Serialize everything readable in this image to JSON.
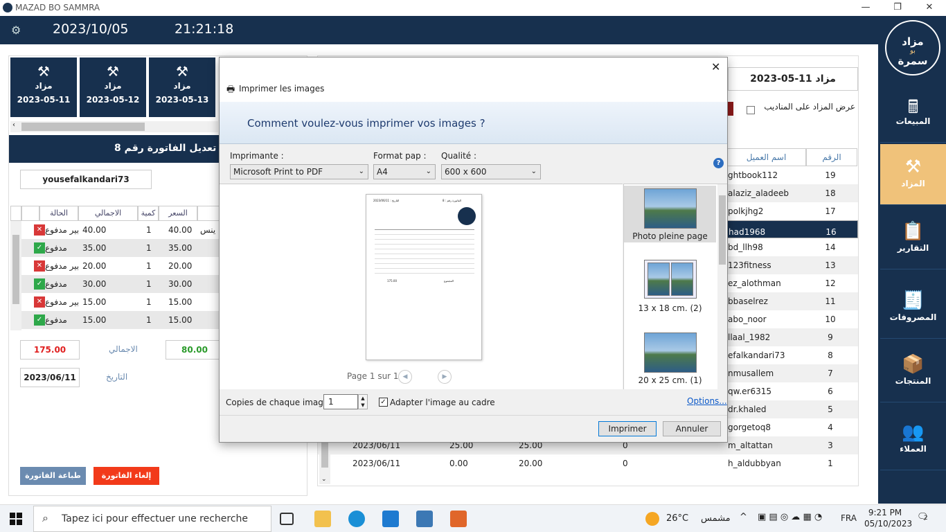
{
  "window": {
    "title": "MAZAD BO SAMMRA",
    "min": "—",
    "max": "❐",
    "close": "✕"
  },
  "topbar": {
    "date": "2023/10/05",
    "time": "21:21:18",
    "gear": "⚙"
  },
  "sidebar": {
    "logo_line1": "مزاد",
    "logo_line2": "بو",
    "logo_line3": "سمرة",
    "logo_sub": "MAZAD BO SAMMRA",
    "items": [
      {
        "label": "المبيعات",
        "icon": "cash-register-icon",
        "glyph": "🖩"
      },
      {
        "label": "المزاد",
        "icon": "gavel-icon",
        "glyph": "⚒"
      },
      {
        "label": "التقارير",
        "icon": "report-icon",
        "glyph": "📋"
      },
      {
        "label": "المصروفات",
        "icon": "expenses-icon",
        "glyph": "🧾"
      },
      {
        "label": "المنتجات",
        "icon": "products-icon",
        "glyph": "📦"
      },
      {
        "label": "العملاء",
        "icon": "customers-icon",
        "glyph": "👥"
      }
    ]
  },
  "left": {
    "cards": [
      {
        "l1": "مزاد",
        "l2": "2023-05-11"
      },
      {
        "l1": "مزاد",
        "l2": "2023-05-12"
      },
      {
        "l1": "مزاد",
        "l2": "2023-05-13"
      }
    ],
    "invoice_title": "تعديل الفاتورة رقم  8",
    "customer": "yousefalkandari73",
    "headers": {
      "status": "الحالة",
      "total": "الاجمالي",
      "qty": "كمية",
      "price": "السعر"
    },
    "rows": [
      {
        "total": "40.00",
        "qty": "1",
        "price": "40.00",
        "status": "بير مدفوع",
        "paid": false,
        "extra": "ينس"
      },
      {
        "total": "35.00",
        "qty": "1",
        "price": "35.00",
        "status": "مدفوع",
        "paid": true,
        "extra": ""
      },
      {
        "total": "20.00",
        "qty": "1",
        "price": "20.00",
        "status": "بير مدفوع",
        "paid": false,
        "extra": ""
      },
      {
        "total": "30.00",
        "qty": "1",
        "price": "30.00",
        "status": "مدفوع",
        "paid": true,
        "extra": ""
      },
      {
        "total": "15.00",
        "qty": "1",
        "price": "15.00",
        "status": "بير مدفوع",
        "paid": false,
        "extra": ""
      },
      {
        "total": "15.00",
        "qty": "1",
        "price": "15.00",
        "status": "مدفوع",
        "paid": true,
        "extra": ""
      }
    ],
    "grand_total": "175.00",
    "total_label": "الاجمالي",
    "paid_total": "80.00",
    "date_value": "2023/06/11",
    "date_label": "التاريخ",
    "print_btn": "طباعة الفاتورة",
    "cancel_btn": "إلغاء الفاتورة"
  },
  "right": {
    "auction_title": "مزاد 11-05-2023",
    "checkbox_label": "عرض المزاد على المناديب",
    "col_num": "الرقم",
    "col_name": "اسم العميل",
    "rows": [
      {
        "num": "19",
        "name": "ghtbook112"
      },
      {
        "num": "18",
        "name": "alaziz_aladeeb"
      },
      {
        "num": "17",
        "name": "polkjhg2"
      },
      {
        "num": "16",
        "name": "had1968"
      },
      {
        "num": "14",
        "name": "bd_llh98"
      },
      {
        "num": "13",
        "name": "123fitness"
      },
      {
        "num": "12",
        "name": "ez_alothman"
      },
      {
        "num": "11",
        "name": "bbaselrez"
      },
      {
        "num": "10",
        "name": "abo_noor"
      },
      {
        "num": "9",
        "name": "llaal_1982"
      },
      {
        "num": "8",
        "name": "efalkandari73"
      },
      {
        "num": "7",
        "name": "nmusallem"
      },
      {
        "num": "6",
        "name": "qw.er6315"
      },
      {
        "num": "5",
        "name": "dr.khaled"
      },
      {
        "num": "4",
        "name": "gorgetoq8"
      },
      {
        "num": "3",
        "name": "m_altattan",
        "date": "2023/06/11",
        "a": "25.00",
        "b": "25.00",
        "c": "0"
      },
      {
        "num": "1",
        "name": "h_aldubbyan",
        "date": "2023/06/11",
        "a": "0.00",
        "b": "20.00",
        "c": "0"
      }
    ]
  },
  "dialog": {
    "title": "Imprimer les images",
    "question": "Comment voulez-vous imprimer vos images ?",
    "printer_label": "Imprimante :",
    "printer": "Microsoft Print to PDF",
    "paper_label": "Format pap :",
    "paper": "A4",
    "quality_label": "Qualité :",
    "quality": "600 x 600",
    "page_info": "Page 1 sur 1",
    "thumbs": [
      {
        "label": "Photo pleine page"
      },
      {
        "label": "13 x 18 cm. (2)"
      },
      {
        "label": "20 x 25 cm. (1)"
      }
    ],
    "copies_label": "Copies de chaque image :",
    "copies": "1",
    "fit_label": "Adapter l'image au cadre",
    "options": "Options...",
    "print": "Imprimer",
    "cancel": "Annuler",
    "doc_title": "الفاتورة رقم : 8",
    "doc_date": "التاريخ : 2023/06/11",
    "doc_total": "175.00",
    "doc_total_label": "المجموع"
  },
  "taskbar": {
    "search": "Tapez ici pour effectuer une recherche",
    "weather": "26°C",
    "weather_text": "مشمس",
    "lang": "FRA",
    "time": "9:21 PM",
    "date": "05/10/2023",
    "notif": "2"
  }
}
